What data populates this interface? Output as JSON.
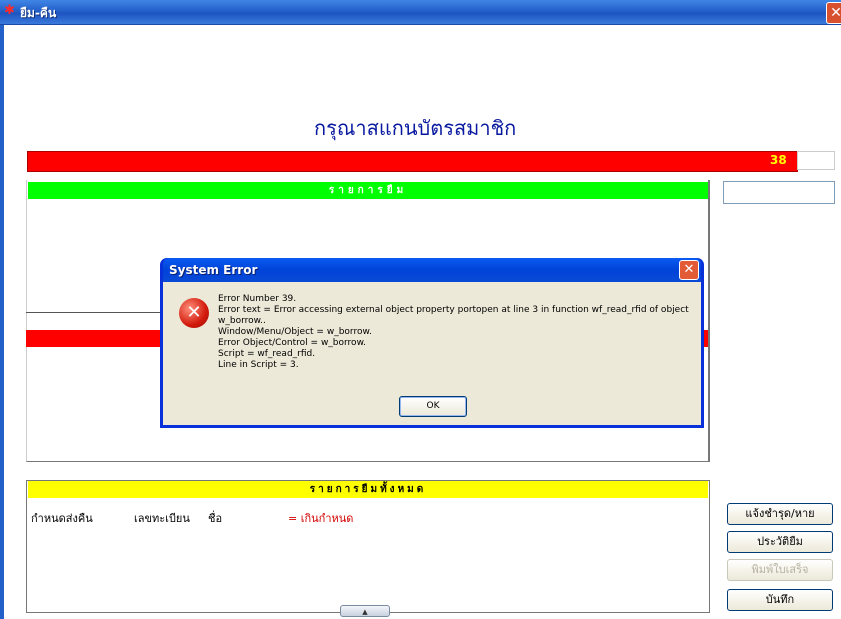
{
  "window": {
    "title": "ยืม-คืน",
    "icon": "app-logo-icon",
    "close_glyph": "✕"
  },
  "main": {
    "heading": "กรุณาสแกนบัตรสมาชิก",
    "counter": "38",
    "borrow_list_header": "รายการยืม",
    "all_list_header": "รายการยืมทั้งหมด",
    "columns": {
      "due": "กำหนดส่งคืน",
      "reg": "เลขทะเบียน",
      "name": "ชื่อ",
      "overdue": "= เกินกำหนด"
    },
    "scroll_glyph": "▲"
  },
  "side_buttons": {
    "report_damage": "แจ้งชำรุด/หาย",
    "history": "ประวัติยืม",
    "print_receipt": "พิมพ์ใบเสร็จ",
    "save": "บันทึก"
  },
  "dialog": {
    "title": "System Error",
    "lines": [
      "Error Number 39.",
      "Error text = Error accessing external object property portopen at line 3 in function wf_read_rfid of object w_borrow..",
      "Window/Menu/Object = w_borrow.",
      "Error Object/Control = w_borrow.",
      "Script = wf_read_rfid.",
      "Line in Script = 3."
    ],
    "ok_label": "OK",
    "close_glyph": "✕",
    "icon_glyph": "✕"
  },
  "colors": {
    "red_bar": "#ff0000",
    "green_header": "#00ff00",
    "yellow_header": "#ffff00",
    "heading": "#0a1aa0"
  }
}
